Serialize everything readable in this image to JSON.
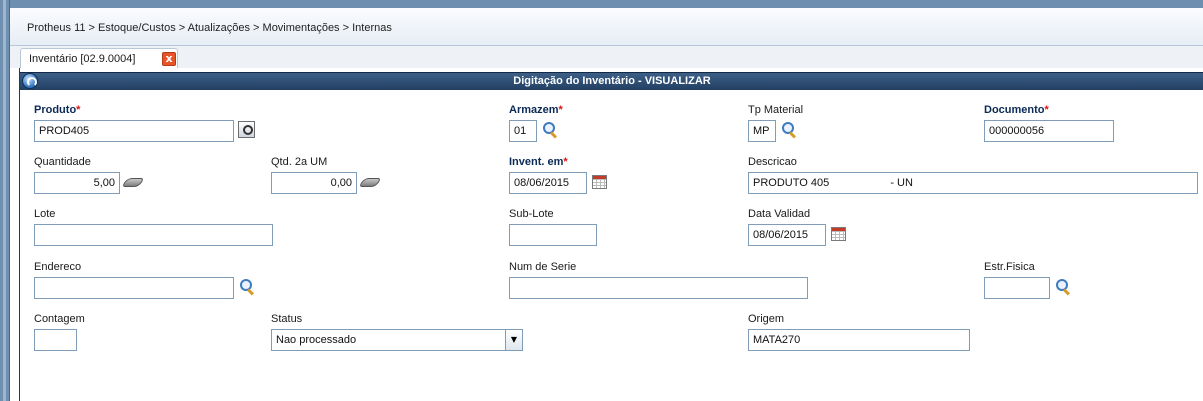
{
  "breadcrumb": "Protheus 11 > Estoque/Custos > Atualizações > Movimentações > Internas",
  "tab": {
    "label": "Inventário [02.9.0004]",
    "close": "x"
  },
  "panel": {
    "title": "Digitação do Inventário - VISUALIZAR"
  },
  "fields": {
    "produto": {
      "label": "Produto",
      "required": "*",
      "value": "PROD405"
    },
    "armazem": {
      "label": "Armazem",
      "required": "*",
      "value": "01"
    },
    "tp_material": {
      "label": "Tp Material",
      "value": "MP"
    },
    "documento": {
      "label": "Documento",
      "required": "*",
      "value": "000000056"
    },
    "quantidade": {
      "label": "Quantidade",
      "value": "5,00"
    },
    "qtd_2a_um": {
      "label": "Qtd. 2a UM",
      "value": "0,00"
    },
    "invent_em": {
      "label": "Invent. em",
      "required": "*",
      "value": "08/06/2015"
    },
    "descricao": {
      "label": "Descricao",
      "value": "PRODUTO 405                    - UN"
    },
    "lote": {
      "label": "Lote",
      "value": ""
    },
    "sub_lote": {
      "label": "Sub-Lote",
      "value": ""
    },
    "data_validad": {
      "label": "Data Validad",
      "value": "08/06/2015"
    },
    "endereco": {
      "label": "Endereco",
      "value": ""
    },
    "num_de_serie": {
      "label": "Num de Serie",
      "value": ""
    },
    "estr_fisica": {
      "label": "Estr.Fisica",
      "value": ""
    },
    "contagem": {
      "label": "Contagem",
      "value": ""
    },
    "status": {
      "label": "Status",
      "value": "Nao processado",
      "arrow": "▼"
    },
    "origem": {
      "label": "Origem",
      "value": "MATA270"
    }
  },
  "colors": {
    "header_bg": "#223f63",
    "required_star": "#dd1111",
    "input_border": "#7f9db9",
    "tab_close_bg": "#e8542a"
  },
  "icons": [
    "help-icon",
    "close-icon",
    "lookup-icon",
    "search-icon",
    "calculator-icon",
    "calendar-icon",
    "chevron-down-icon"
  ]
}
